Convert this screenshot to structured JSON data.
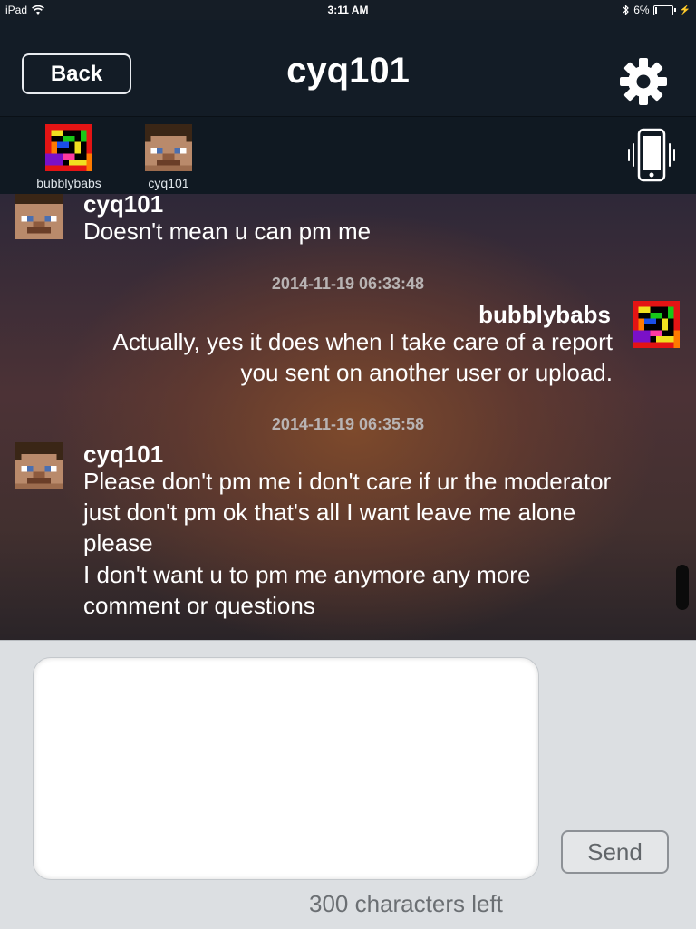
{
  "status_bar": {
    "device": "iPad",
    "time": "3:11 AM",
    "battery": "6%"
  },
  "nav": {
    "back_label": "Back",
    "title": "cyq101"
  },
  "participants": [
    {
      "name": "bubblybabs",
      "avatar": "rainbow-pixel-avatar"
    },
    {
      "name": "cyq101",
      "avatar": "steve-pixel-avatar"
    }
  ],
  "messages": [
    {
      "sender": "cyq101",
      "side": "left",
      "lines": [
        "Doesn't mean u can pm me"
      ]
    },
    {
      "timestamp": "2014-11-19 06:33:48",
      "sender": "bubblybabs",
      "side": "right",
      "lines": [
        "Actually, yes it does when I take care of a report",
        "you sent on another user or upload."
      ]
    },
    {
      "timestamp": "2014-11-19 06:35:58",
      "sender": "cyq101",
      "side": "left",
      "lines": [
        "Please don't pm me i don't care if ur the moderator",
        "just don't pm ok that's all I want leave me alone",
        "please",
        "I don't want u to pm me anymore any more",
        "comment or questions"
      ]
    }
  ],
  "compose": {
    "input_value": "",
    "send_label": "Send",
    "counter": "300 characters left"
  }
}
